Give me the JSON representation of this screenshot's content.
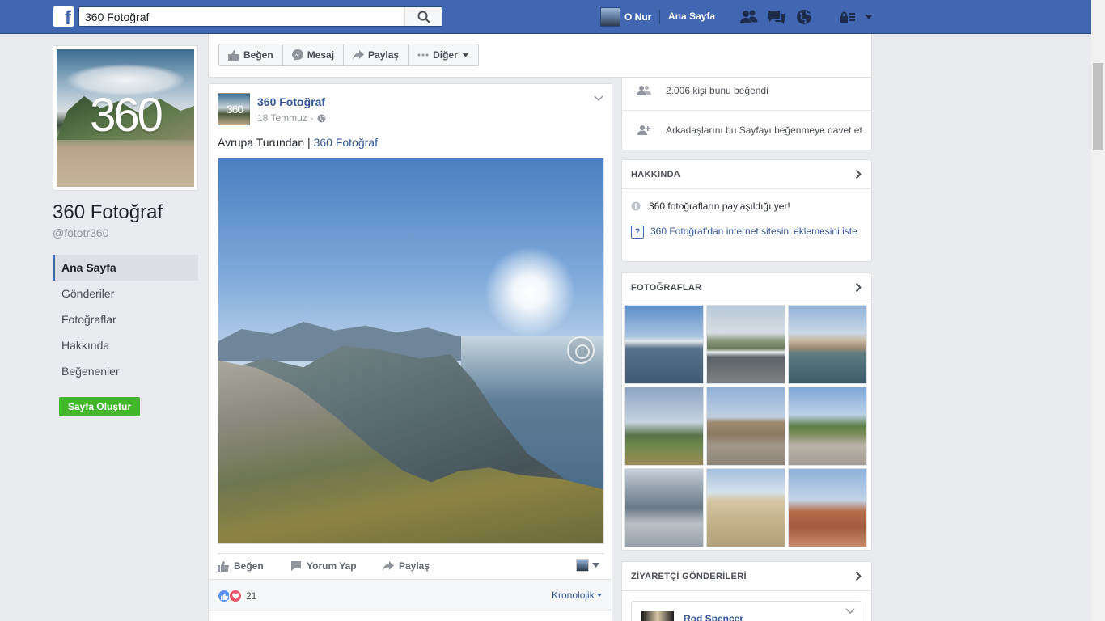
{
  "topbar": {
    "logo_glyph": "f",
    "search_value": "360 Fotoğraf",
    "user_name": "O Nur",
    "home_label": "Ana Sayfa"
  },
  "profile": {
    "logo_text": "360",
    "name": "360 Fotoğraf",
    "handle": "@fototr360"
  },
  "side_nav": [
    {
      "label": "Ana Sayfa"
    },
    {
      "label": "Gönderiler"
    },
    {
      "label": "Fotoğraflar"
    },
    {
      "label": "Hakkında"
    },
    {
      "label": "Beğenenler"
    }
  ],
  "create_page_label": "Sayfa Oluştur",
  "action_bar": {
    "like": "Beğen",
    "message": "Mesaj",
    "share": "Paylaş",
    "more": "Diğer"
  },
  "post": {
    "avatar_text": "360",
    "author": "360 Fotoğraf",
    "date": "18 Temmuz",
    "text_plain": "Avrupa Turundan |",
    "text_link": "360 Fotoğraf",
    "actions": {
      "like": "Beğen",
      "comment": "Yorum Yap",
      "share": "Paylaş"
    },
    "reaction_count": "21",
    "sort_label": "Kronolojik"
  },
  "right": {
    "likes_text": "2.006 kişi bunu beğendi",
    "invite_text": "Arkadaşlarını bu Sayfayı beğenmeye davet et",
    "about_title": "HAKKINDA",
    "about_desc": "360 fotoğrafların paylaşıldığı yer!",
    "about_website_prompt": "360 Fotoğraf'dan internet sitesini eklemesini iste",
    "photos_title": "FOTOĞRAFLAR",
    "visitor_title": "ZİYARETÇİ GÖNDERİLERİ",
    "visitor_name": "Rod Spencer"
  },
  "colors": {
    "brand_blue": "#4267b2",
    "link_blue": "#365899",
    "green": "#42b72a",
    "background": "#e9ebee"
  }
}
